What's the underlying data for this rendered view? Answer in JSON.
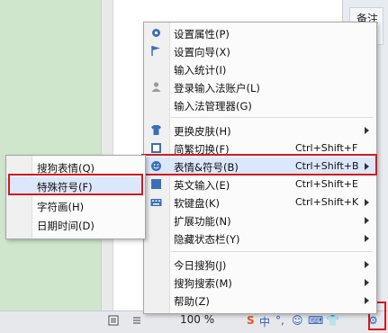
{
  "side_panel": {
    "note_label": "备注"
  },
  "statusbar": {
    "zoom": "100 %"
  },
  "ime_bar": {
    "items": [
      "S",
      "中",
      "°,",
      "☺",
      "⌨",
      "👕",
      "⚙"
    ]
  },
  "main_menu": {
    "items": [
      {
        "label": "设置属性(P)",
        "icon": "gear-icon"
      },
      {
        "label": "设置向导(X)",
        "icon": "flag-icon"
      },
      {
        "label": "输入统计(I)",
        "icon": ""
      },
      {
        "label": "登录输入法账户(L)",
        "icon": "user-icon"
      },
      {
        "label": "输入法管理器(G)",
        "icon": ""
      },
      {
        "label": "更换皮肤(H)",
        "icon": "shirt-icon",
        "submenu": true
      },
      {
        "label": "简繁切换(F)",
        "icon": "convert-icon",
        "shortcut": "Ctrl+Shift+F"
      },
      {
        "label": "表情&符号(B)",
        "icon": "smiley-icon",
        "shortcut": "Ctrl+Shift+B",
        "submenu": true
      },
      {
        "label": "英文输入(E)",
        "icon": "english-icon",
        "shortcut": "Ctrl+Shift+E"
      },
      {
        "label": "软键盘(K)",
        "icon": "keyboard-icon",
        "shortcut": "Ctrl+Shift+K",
        "submenu": true
      },
      {
        "label": "扩展功能(N)",
        "icon": "",
        "submenu": true
      },
      {
        "label": "隐藏状态栏(Y)",
        "icon": "",
        "submenu": true
      },
      {
        "label": "今日搜狗(J)",
        "icon": "",
        "submenu": true
      },
      {
        "label": "搜狗搜索(M)",
        "icon": "",
        "submenu": true
      },
      {
        "label": "帮助(Z)",
        "icon": "",
        "submenu": true
      }
    ]
  },
  "sub_menu": {
    "items": [
      {
        "label": "搜狗表情(Q)"
      },
      {
        "label": "特殊符号(F)"
      },
      {
        "label": "字符画(H)"
      },
      {
        "label": "日期时间(D)"
      }
    ]
  }
}
